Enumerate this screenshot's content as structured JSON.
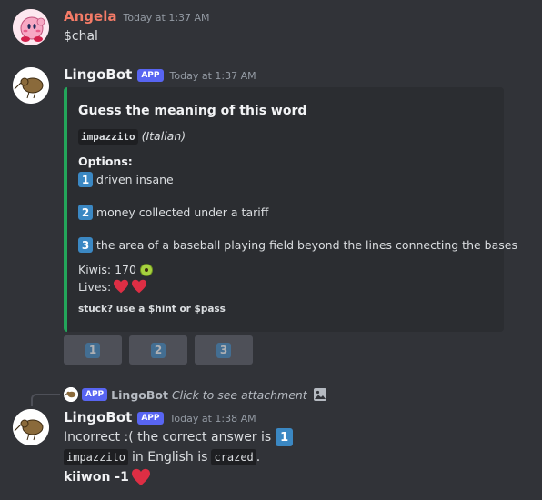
{
  "messages": [
    {
      "author": "Angela",
      "author_color": "#f47b67",
      "timestamp": "Today at 1:37 AM",
      "content": "$chal"
    },
    {
      "author": "LingoBot",
      "badge": "APP",
      "timestamp": "Today at 1:37 AM",
      "embed": {
        "accent_color": "#23a55a",
        "title": "Guess the meaning of this word",
        "word": "impazzito",
        "language": "(Italian)",
        "options_heading": "Options:",
        "options": [
          {
            "num": "1",
            "text": "driven insane"
          },
          {
            "num": "2",
            "text": "money collected under a tariff"
          },
          {
            "num": "3",
            "text": "the area of a baseball playing field beyond the lines connecting the bases"
          }
        ],
        "kiwis_label": "Kiwis: 170",
        "kiwi_icon": "kiwi-emoji-icon",
        "lives_label": "Lives:",
        "lives": 2,
        "footer": "stuck? use a $hint or $pass"
      },
      "buttons": [
        "1",
        "2",
        "3"
      ]
    },
    {
      "reply_to": {
        "badge": "APP",
        "author": "LingoBot",
        "text": "Click to see attachment",
        "icon": "image-icon"
      },
      "author": "LingoBot",
      "badge": "APP",
      "timestamp": "Today at 1:38 AM",
      "line1": "Incorrect :( the correct answer is",
      "line1_num": "1",
      "line2_code": "impazzito",
      "line2_mid": "in English is",
      "line2_code2": "crazed",
      "line2_end": ".",
      "line3": "kiiwon -1"
    }
  ]
}
